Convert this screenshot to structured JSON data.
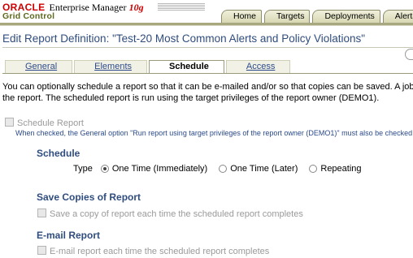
{
  "header": {
    "logo_oracle": "ORACLE",
    "logo_product": "Enterprise Manager",
    "logo_version": "10g",
    "logo_subtitle": "Grid Control",
    "tabs": [
      {
        "label": "Home"
      },
      {
        "label": "Targets"
      },
      {
        "label": "Deployments"
      },
      {
        "label": "Alerts"
      }
    ]
  },
  "page": {
    "title": "Edit Report Definition: \"Test-20 Most Common Alerts and Policy Violations\""
  },
  "subtabs": [
    {
      "label": "General",
      "active": false
    },
    {
      "label": "Elements",
      "active": false
    },
    {
      "label": "Schedule",
      "active": true
    },
    {
      "label": "Access",
      "active": false
    }
  ],
  "intro": {
    "line1": "You can optionally schedule a report so that it can be e-mailed and/or so that copies can be saved. A job is s",
    "line2": "the report. The scheduled report is run using the target privileges of the report owner (DEMO1)."
  },
  "schedule_report": {
    "label": "Schedule Report",
    "hint": "When checked, the General option \"Run report using target privileges of the report owner (DEMO1)\" must also be checked",
    "checked": false
  },
  "schedule": {
    "heading": "Schedule",
    "type_label": "Type",
    "options": [
      {
        "label": "One Time (Immediately)",
        "selected": true
      },
      {
        "label": "One Time (Later)",
        "selected": false
      },
      {
        "label": "Repeating",
        "selected": false
      }
    ]
  },
  "save_copies": {
    "heading": "Save Copies of Report",
    "checkbox_label": "Save a copy of report each time the scheduled report completes"
  },
  "email": {
    "heading": "E-mail Report",
    "checkbox_label": "E-mail report each time the scheduled report completes"
  },
  "colors": {
    "accent": "#2f4d7e",
    "brand_red": "#cc0000",
    "disabled_text": "#9a9a9a"
  }
}
